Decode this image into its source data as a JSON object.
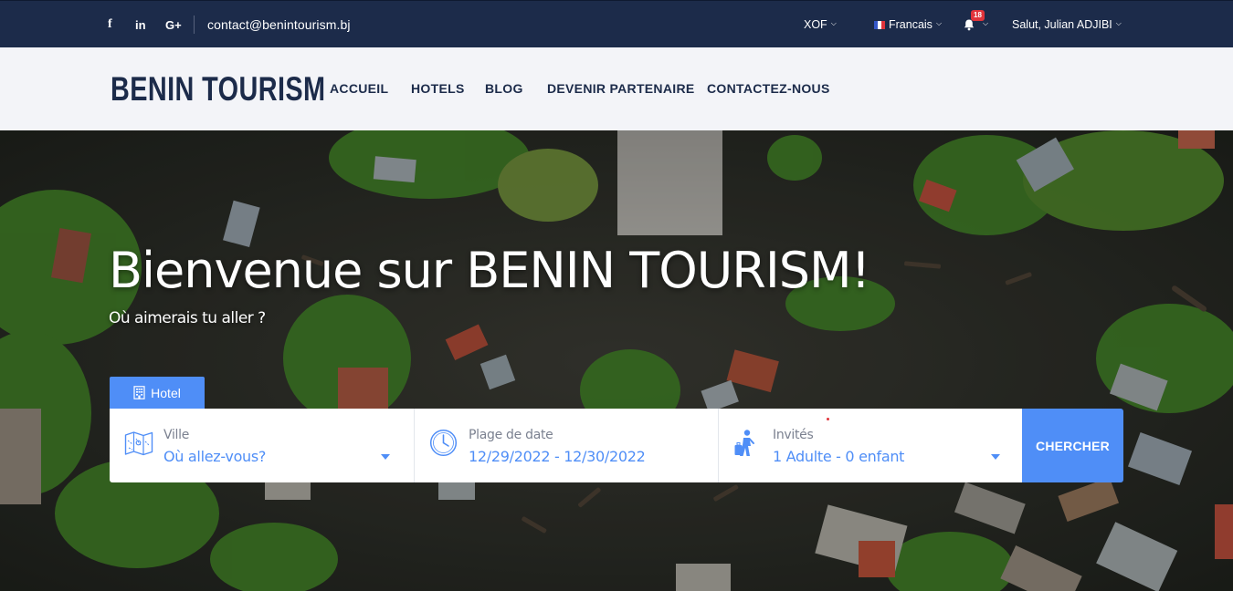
{
  "topbar": {
    "social": [
      "f",
      "in",
      "G+"
    ],
    "email": "contact@benintourism.bj",
    "currency": "XOF",
    "language": "Francais",
    "notification_count": "18",
    "greeting": "Salut, Julian ADJIBI"
  },
  "nav": {
    "logo": "BENIN TOURISM",
    "links": [
      "ACCUEIL",
      "HOTELS",
      "BLOG",
      "DEVENIR PARTENAIRE",
      "CONTACTEZ-NOUS"
    ]
  },
  "hero": {
    "title": "Bienvenue sur BENIN TOURISM!",
    "subtitle": "Où aimerais tu aller ?"
  },
  "search": {
    "tab_label": "Hotel",
    "city_label": "Ville",
    "city_value": "Où  allez-vous?",
    "date_label": "Plage de date",
    "date_value": "12/29/2022 - 12/30/2022",
    "guests_label": "Invités",
    "guests_value": "1 Adulte - 0 enfant",
    "submit_label": "CHERCHER"
  },
  "colors": {
    "navy": "#1c2b4a",
    "accent_blue": "#4f8ef7",
    "badge_red": "#e1343b",
    "nav_bg": "#f3f4f8"
  },
  "icons": [
    "facebook-icon",
    "linkedin-icon",
    "google-plus-icon",
    "bell-icon",
    "chevron-down-icon",
    "building-icon",
    "map-icon",
    "clock-icon",
    "traveler-luggage-icon",
    "caret-down-icon"
  ]
}
